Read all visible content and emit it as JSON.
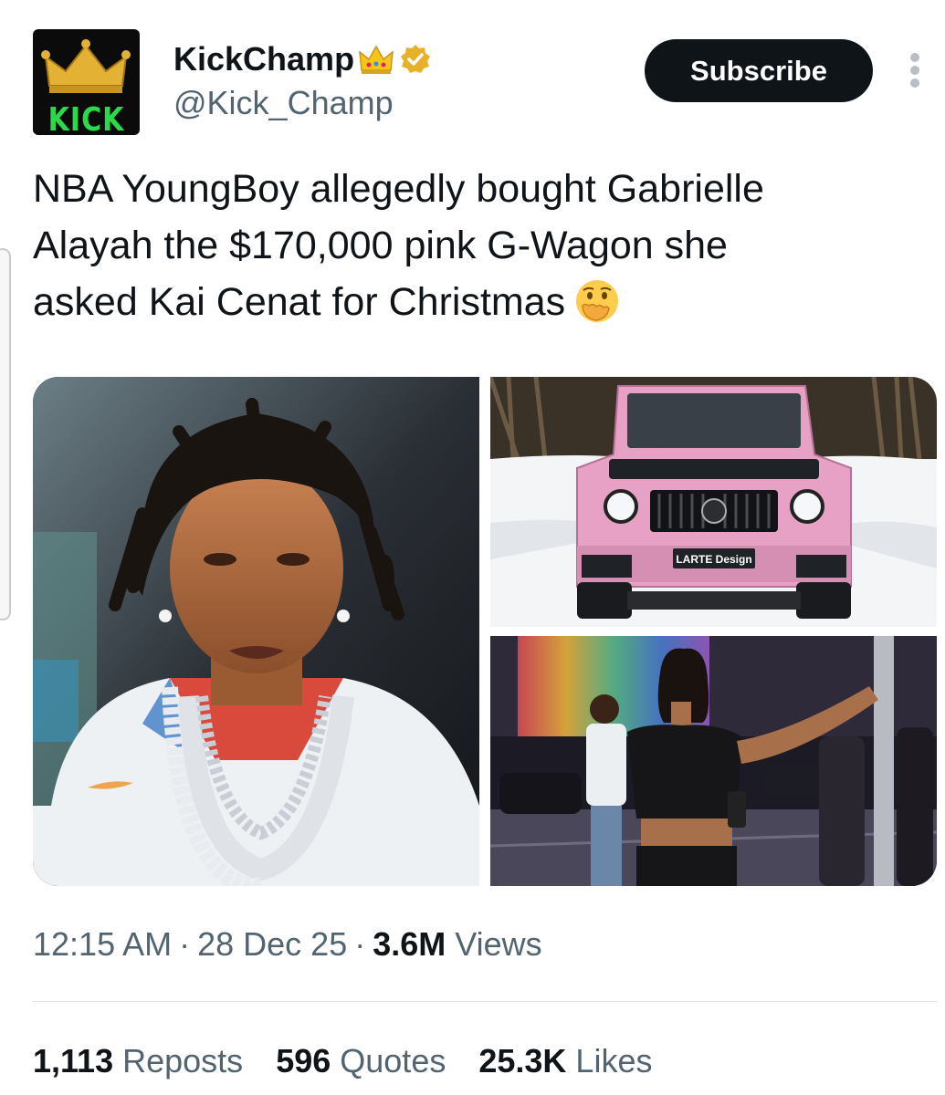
{
  "author": {
    "display_name": "KickChamp",
    "handle": "@Kick_Champ",
    "avatar_text": "KICK",
    "verified": true
  },
  "header": {
    "subscribe_label": "Subscribe"
  },
  "tweet": {
    "text_lines": [
      "NBA YoungBoy allegedly bought Gabrielle",
      "Alayah the $170,000 pink G-Wagon she",
      "asked Kai Cenat for Christmas"
    ],
    "emoji": "face-with-hand-over-mouth"
  },
  "media": {
    "watermark": "LARTE Design"
  },
  "meta": {
    "time": "12:15 AM",
    "date": "28 Dec 25",
    "views_count": "3.6M",
    "views_label": "Views"
  },
  "stats": {
    "reposts_count": "1,113",
    "reposts_label": "Reposts",
    "quotes_count": "596",
    "quotes_label": "Quotes",
    "likes_count": "25.3K",
    "likes_label": "Likes"
  },
  "colors": {
    "text_primary": "#0f1419",
    "text_secondary": "#536471",
    "button_bg": "#0f1419",
    "verified_gold": "#e8b12a",
    "avatar_green": "#2bd94a",
    "car_pink": "#e7a1c4"
  }
}
